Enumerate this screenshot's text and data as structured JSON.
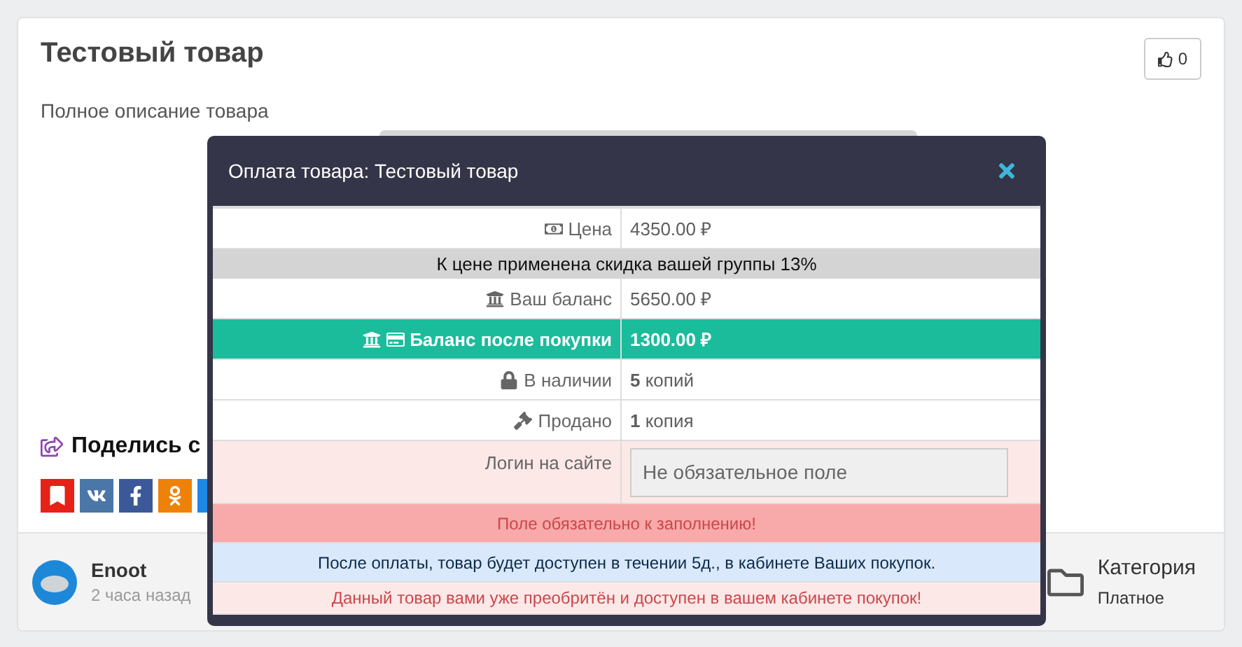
{
  "product": {
    "title": "Тестовый товар",
    "description": "Полное описание товара",
    "likes": "0"
  },
  "share": {
    "title": "Поделись с",
    "buttons": [
      {
        "kind": "bookmark",
        "color": "#e62117"
      },
      {
        "kind": "vk",
        "color": "#4a76a8"
      },
      {
        "kind": "facebook",
        "color": "#3b5998"
      },
      {
        "kind": "ok",
        "color": "#ee8208"
      },
      {
        "kind": "other",
        "color": "#1e88e5"
      }
    ]
  },
  "author": {
    "name": "Enoot",
    "time": "2 часа назад"
  },
  "category": {
    "label": "Категория",
    "value": "Платное"
  },
  "modal": {
    "title": "Оплата товара: Тестовый товар",
    "rows": [
      {
        "kind": "price",
        "label": "Цена",
        "value": "4350.00 ₽",
        "highlight": false
      },
      {
        "kind": "notice",
        "text": "К цене применена скидка вашей группы 13%"
      },
      {
        "kind": "balance",
        "label": "Ваш баланс",
        "value": "5650.00 ₽",
        "highlight": false
      },
      {
        "kind": "balance_after",
        "label": "Баланс после покупки",
        "value": "1300.00 ₽",
        "highlight": true
      },
      {
        "kind": "stock",
        "label": "В наличии",
        "value": "**5** копий",
        "highlight": false
      },
      {
        "kind": "sold",
        "label": "Продано",
        "value": "**1** копия",
        "highlight": false
      },
      {
        "kind": "input",
        "label": "Логин на сайте",
        "placeholder": "Не обязательное поле"
      }
    ],
    "messages": [
      {
        "kind": "error",
        "text": "Поле обязательно к заполнению!"
      },
      {
        "kind": "info",
        "text": "После оплаты, товар будет доступен в течении 5д., в кабинете Ваших покупок."
      },
      {
        "kind": "warning",
        "text": "Данный товар вами уже преобритён и доступен в вашем кабинете покупок!"
      }
    ]
  }
}
